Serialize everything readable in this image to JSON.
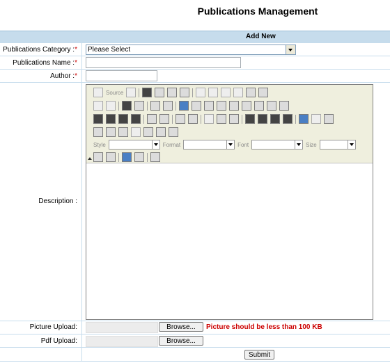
{
  "page": {
    "title": "Publications Management"
  },
  "form": {
    "header": "Add New",
    "category_label": "Publications Category :",
    "category_value": "Please Select",
    "name_label": "Publications Name :",
    "author_label": "Author :",
    "required_marker": "*",
    "description_label": "Description :",
    "picture_label": "Picture Upload:",
    "picture_browse": "Browse...",
    "picture_warning": "Picture should be less than 100 KB",
    "pdf_label": "Pdf Upload:",
    "pdf_browse": "Browse...",
    "submit_label": "Submit"
  },
  "editor": {
    "source_label": "Source",
    "style_label": "Style",
    "format_label": "Format",
    "font_label": "Font",
    "size_label": "Size",
    "icons_row1": [
      "source-icon",
      "templates-icon",
      "save-icon",
      "new-page-icon",
      "preview-icon",
      "paste-icon",
      "cut-icon",
      "copy-icon",
      "paste-text-icon",
      "paste-word-icon",
      "print-icon",
      "spellcheck-icon"
    ],
    "icons_row2": [
      "undo-icon",
      "redo-icon",
      "find-icon",
      "replace-icon",
      "select-all-icon",
      "remove-format-icon",
      "form-icon",
      "checkbox-icon",
      "radio-icon",
      "textfield-icon",
      "textarea-icon",
      "select-field-icon",
      "button-icon",
      "image-button-icon",
      "hidden-field-icon"
    ],
    "icons_row3": [
      "bold-icon",
      "italic-icon",
      "underline-icon",
      "strike-icon",
      "subscript-icon",
      "superscript-icon",
      "ordered-list-icon",
      "unordered-list-icon",
      "outdent-icon",
      "indent-icon",
      "blockquote-icon",
      "align-left-icon",
      "align-center-icon",
      "align-right-icon",
      "justify-icon",
      "link-icon",
      "unlink-icon",
      "anchor-icon"
    ],
    "icons_row4": [
      "image-icon",
      "flash-icon",
      "table-icon",
      "horizontal-rule-icon",
      "smiley-icon",
      "special-char-icon",
      "page-break-icon"
    ],
    "icons_row6": [
      "text-color-icon",
      "bg-color-icon",
      "maximize-icon",
      "show-blocks-icon",
      "about-icon"
    ]
  }
}
